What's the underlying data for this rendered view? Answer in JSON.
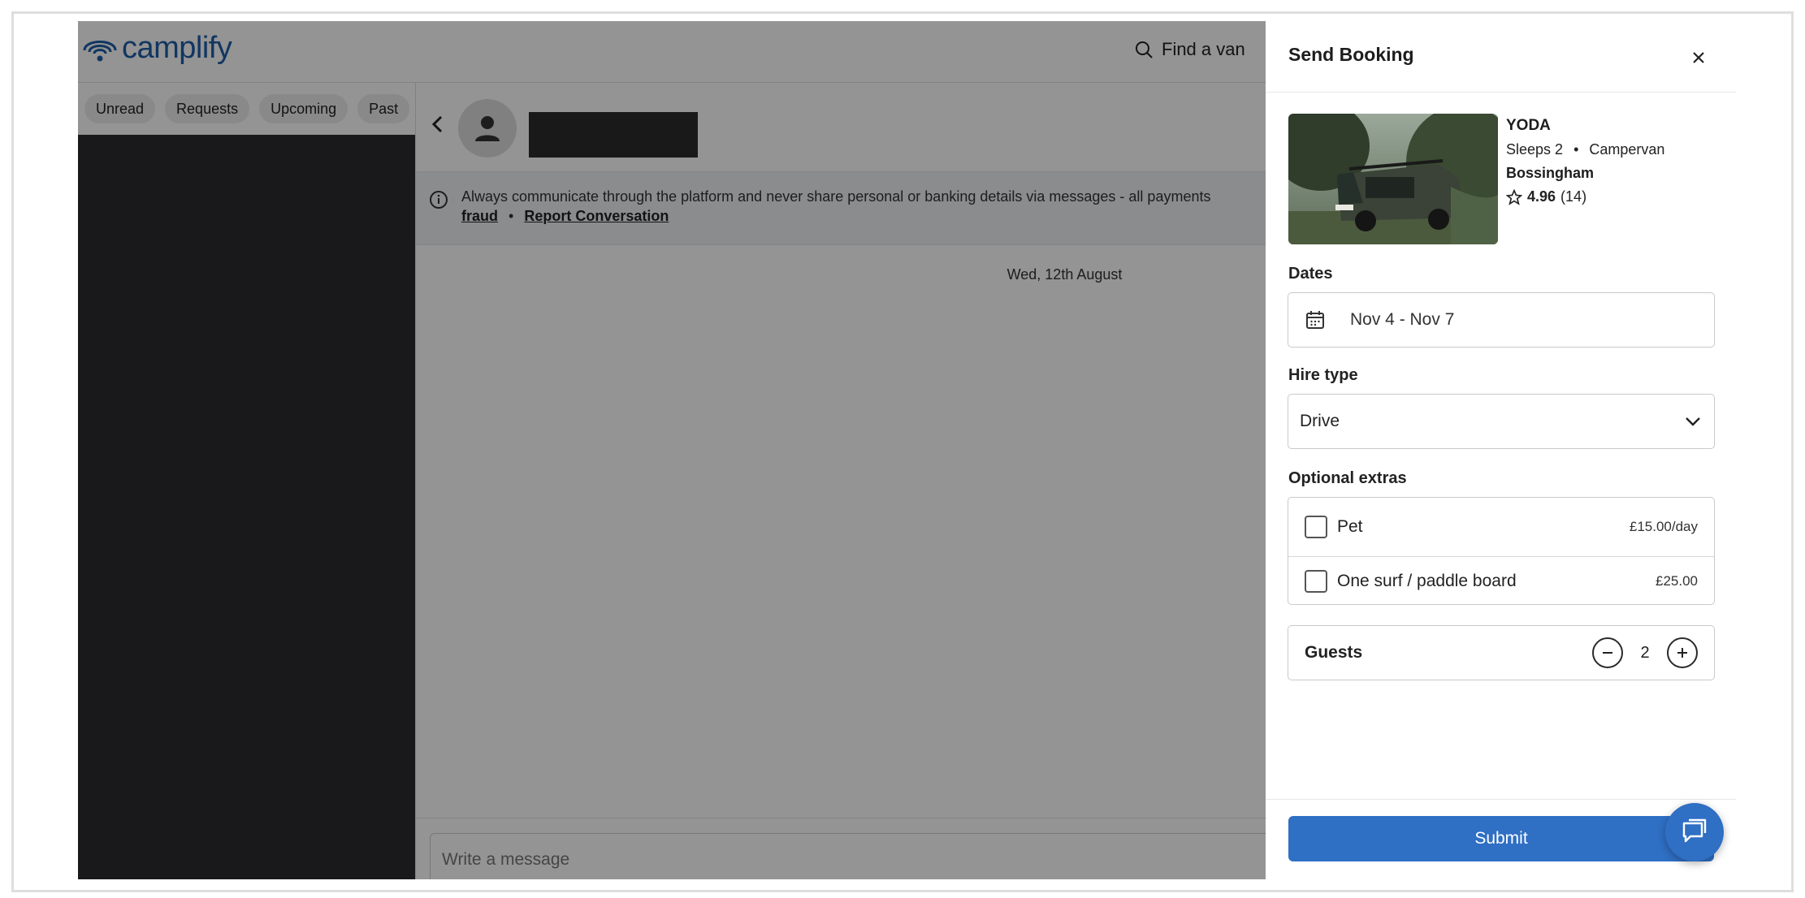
{
  "brand": {
    "name": "camplify",
    "color": "#1e5ea8"
  },
  "nav": {
    "find_van_label": "Find a van",
    "find_van_icon": "search-icon"
  },
  "filters": [
    {
      "label": "Unread"
    },
    {
      "label": "Requests"
    },
    {
      "label": "Upcoming"
    },
    {
      "label": "Past"
    }
  ],
  "conversation": {
    "notice_text": "Always communicate through the platform and never share personal or banking details via messages - all payments",
    "notice_link_fraud": "fraud",
    "notice_separator": "•",
    "notice_link_report": "Report Conversation",
    "date_separator": "Wed, 12th August",
    "composer_placeholder": "Write a message"
  },
  "drawer": {
    "title": "Send Booking",
    "listing": {
      "name": "YODA",
      "sleeps": "Sleeps 2",
      "separator": "•",
      "type": "Campervan",
      "location": "Bossingham",
      "rating": "4.96",
      "reviews": "(14)"
    },
    "dates": {
      "label": "Dates",
      "value": "Nov 4 - Nov 7"
    },
    "hire_type": {
      "label": "Hire type",
      "value": "Drive"
    },
    "extras": {
      "label": "Optional extras",
      "items": [
        {
          "name": "Pet",
          "price": "£15.00/day",
          "checked": false
        },
        {
          "name": "One surf / paddle board",
          "price": "£25.00",
          "checked": false
        }
      ]
    },
    "guests": {
      "label": "Guests",
      "count": "2"
    },
    "submit_label": "Submit"
  },
  "colors": {
    "accent": "#2f6fc4",
    "sidebar_dark": "#2b2c31",
    "overlay": "rgba(0,0,0,0.42)"
  }
}
